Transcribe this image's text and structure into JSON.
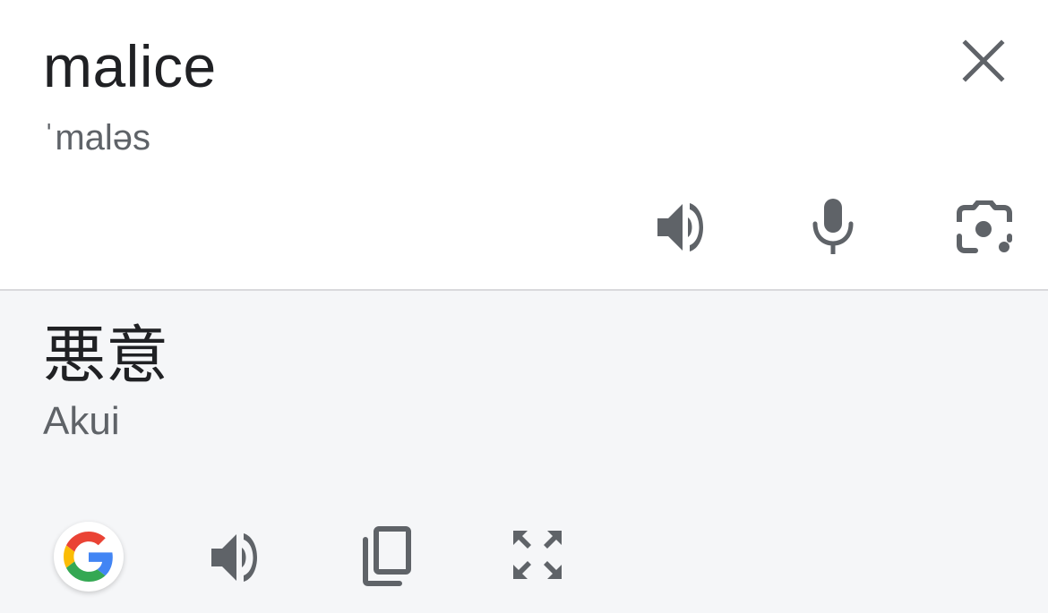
{
  "source": {
    "word": "malice",
    "pronunciation": "ˈmaləs"
  },
  "target": {
    "word": "悪意",
    "transliteration": "Akui"
  },
  "icons": {
    "close": "close-icon",
    "source_listen": "speaker-icon",
    "voice_input": "microphone-icon",
    "camera_input": "google-lens-icon",
    "google": "google-g-logo",
    "target_listen": "speaker-icon",
    "copy": "copy-icon",
    "fullscreen": "fullscreen-icon"
  },
  "colors": {
    "text_primary": "#202124",
    "text_secondary": "#5f6368",
    "icon_gray": "#5f6368",
    "target_background": "#f5f6f8",
    "google_blue": "#4285F4",
    "google_red": "#EA4335",
    "google_yellow": "#FBBC05",
    "google_green": "#34A853"
  }
}
